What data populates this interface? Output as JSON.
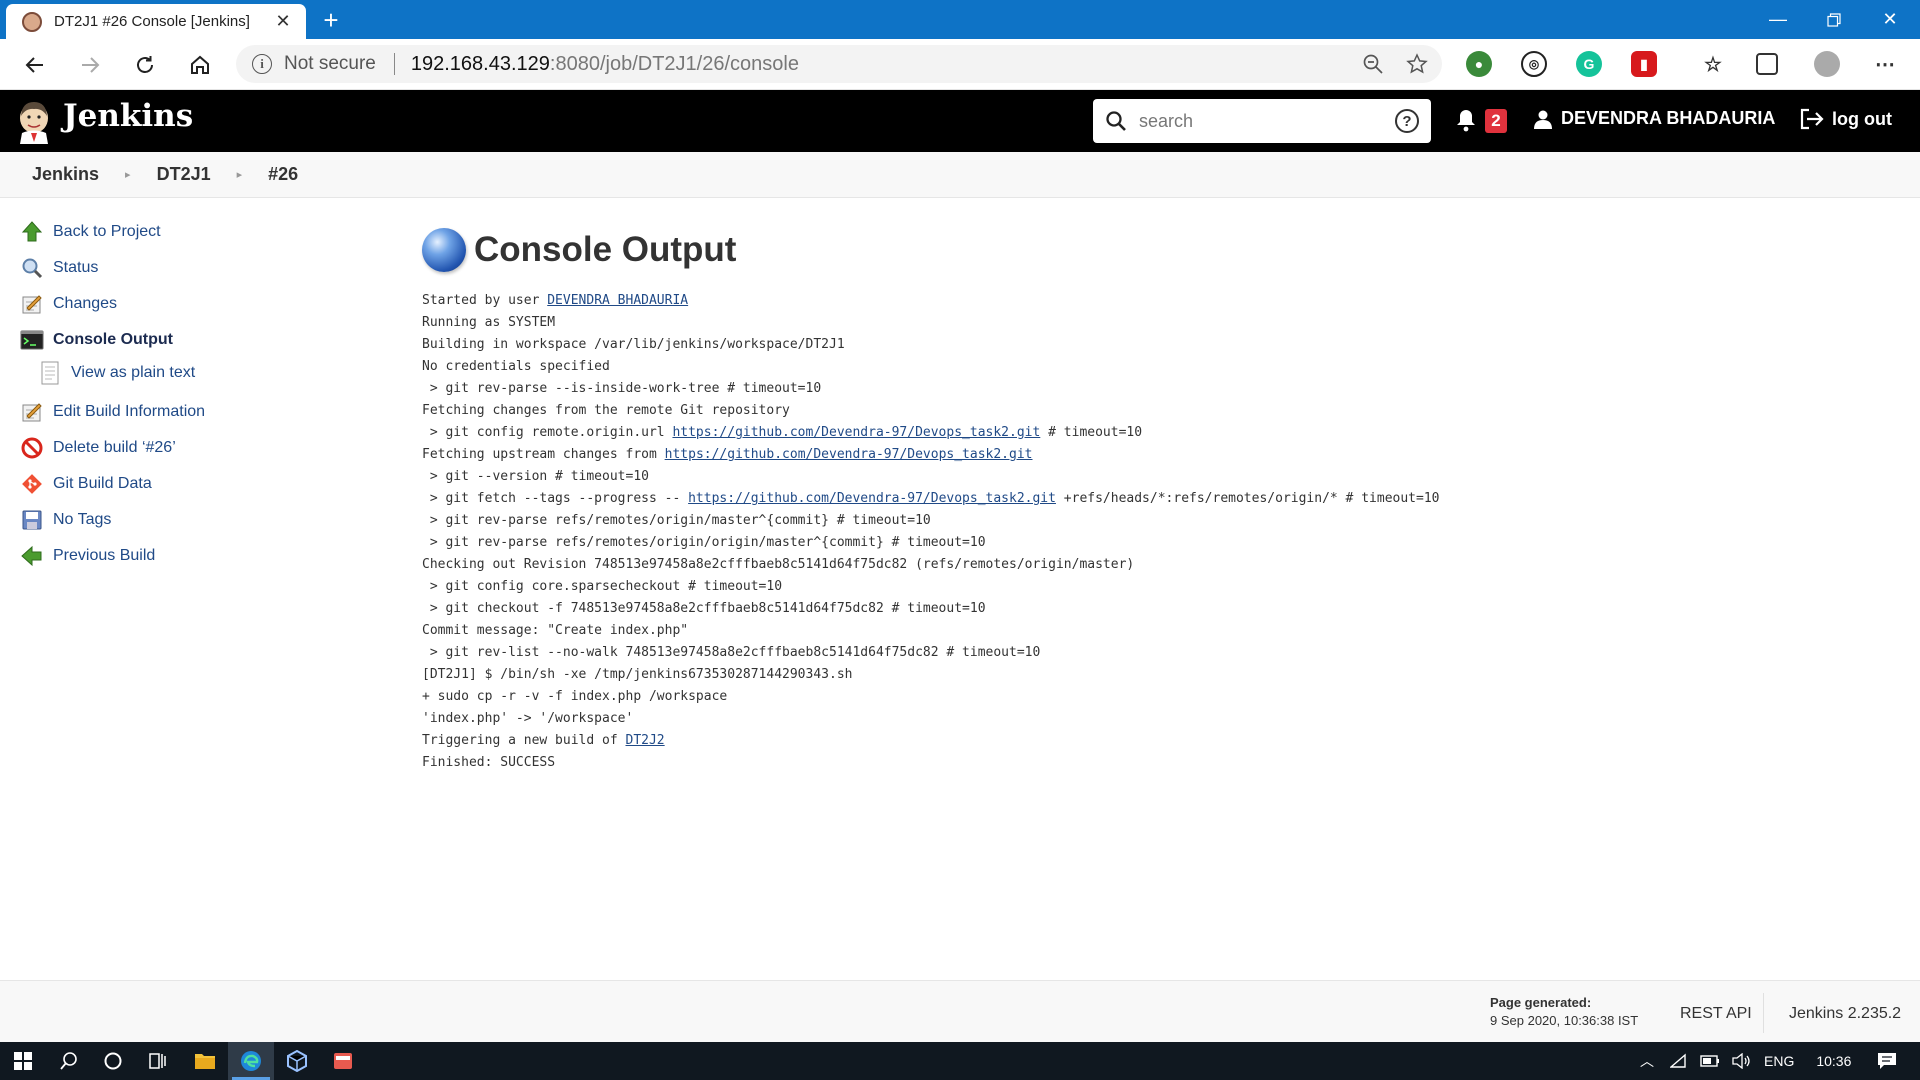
{
  "browser": {
    "tab_title": "DT2J1 #26 Console [Jenkins]",
    "not_secure": "Not secure",
    "url_host": "192.168.43.129",
    "url_path": ":8080/job/DT2J1/26/console"
  },
  "header": {
    "brand": "Jenkins",
    "search_placeholder": "search",
    "notification_count": "2",
    "username": "DEVENDRA BHADAURIA",
    "logout": "log out"
  },
  "breadcrumb": [
    "Jenkins",
    "DT2J1",
    "#26"
  ],
  "sidebar": {
    "items": [
      {
        "label": "Back to Project",
        "icon": "up-arrow-icon"
      },
      {
        "label": "Status",
        "icon": "magnifier-icon"
      },
      {
        "label": "Changes",
        "icon": "notepad-icon"
      },
      {
        "label": "Console Output",
        "icon": "terminal-icon"
      },
      {
        "label": "View as plain text",
        "icon": "document-icon"
      },
      {
        "label": "Edit Build Information",
        "icon": "notepad-icon"
      },
      {
        "label": "Delete build ‘#26’",
        "icon": "no-entry-icon"
      },
      {
        "label": "Git Build Data",
        "icon": "git-icon"
      },
      {
        "label": "No Tags",
        "icon": "save-icon"
      },
      {
        "label": "Previous Build",
        "icon": "left-arrow-icon"
      }
    ]
  },
  "main": {
    "title": "Console Output",
    "console": [
      [
        {
          "t": "Started by user "
        },
        {
          "t": "DEVENDRA BHADAURIA",
          "link": true
        }
      ],
      [
        {
          "t": "Running as SYSTEM"
        }
      ],
      [
        {
          "t": "Building in workspace /var/lib/jenkins/workspace/DT2J1"
        }
      ],
      [
        {
          "t": "No credentials specified"
        }
      ],
      [
        {
          "t": " > git rev-parse --is-inside-work-tree # timeout=10"
        }
      ],
      [
        {
          "t": "Fetching changes from the remote Git repository"
        }
      ],
      [
        {
          "t": " > git config remote.origin.url "
        },
        {
          "t": "https://github.com/Devendra-97/Devops_task2.git",
          "link": true
        },
        {
          "t": " # timeout=10"
        }
      ],
      [
        {
          "t": "Fetching upstream changes from "
        },
        {
          "t": "https://github.com/Devendra-97/Devops_task2.git",
          "link": true
        }
      ],
      [
        {
          "t": " > git --version # timeout=10"
        }
      ],
      [
        {
          "t": " > git fetch --tags --progress -- "
        },
        {
          "t": "https://github.com/Devendra-97/Devops_task2.git",
          "link": true
        },
        {
          "t": " +refs/heads/*:refs/remotes/origin/* # timeout=10"
        }
      ],
      [
        {
          "t": " > git rev-parse refs/remotes/origin/master^{commit} # timeout=10"
        }
      ],
      [
        {
          "t": " > git rev-parse refs/remotes/origin/origin/master^{commit} # timeout=10"
        }
      ],
      [
        {
          "t": "Checking out Revision 748513e97458a8e2cfffbaeb8c5141d64f75dc82 (refs/remotes/origin/master)"
        }
      ],
      [
        {
          "t": " > git config core.sparsecheckout # timeout=10"
        }
      ],
      [
        {
          "t": " > git checkout -f 748513e97458a8e2cfffbaeb8c5141d64f75dc82 # timeout=10"
        }
      ],
      [
        {
          "t": "Commit message: \"Create index.php\""
        }
      ],
      [
        {
          "t": " > git rev-list --no-walk 748513e97458a8e2cfffbaeb8c5141d64f75dc82 # timeout=10"
        }
      ],
      [
        {
          "t": "[DT2J1] $ /bin/sh -xe /tmp/jenkins673530287144290343.sh"
        }
      ],
      [
        {
          "t": "+ sudo cp -r -v -f index.php /workspace"
        }
      ],
      [
        {
          "t": "'index.php' -> '/workspace'"
        }
      ],
      [
        {
          "t": "Triggering a new build of "
        },
        {
          "t": "DT2J2",
          "link": true
        }
      ],
      [
        {
          "t": "Finished: SUCCESS"
        }
      ]
    ]
  },
  "footer": {
    "page_generated_label": "Page generated:",
    "page_generated_value": "9 Sep 2020, 10:36:38 IST",
    "rest_api": "REST API",
    "version": "Jenkins 2.235.2"
  },
  "taskbar": {
    "language": "ENG",
    "time": "10:36"
  },
  "colors": {
    "titlebar": "#0e73c6",
    "jenkins_header": "#000000",
    "link": "#204a87",
    "badge": "#e0323d"
  }
}
